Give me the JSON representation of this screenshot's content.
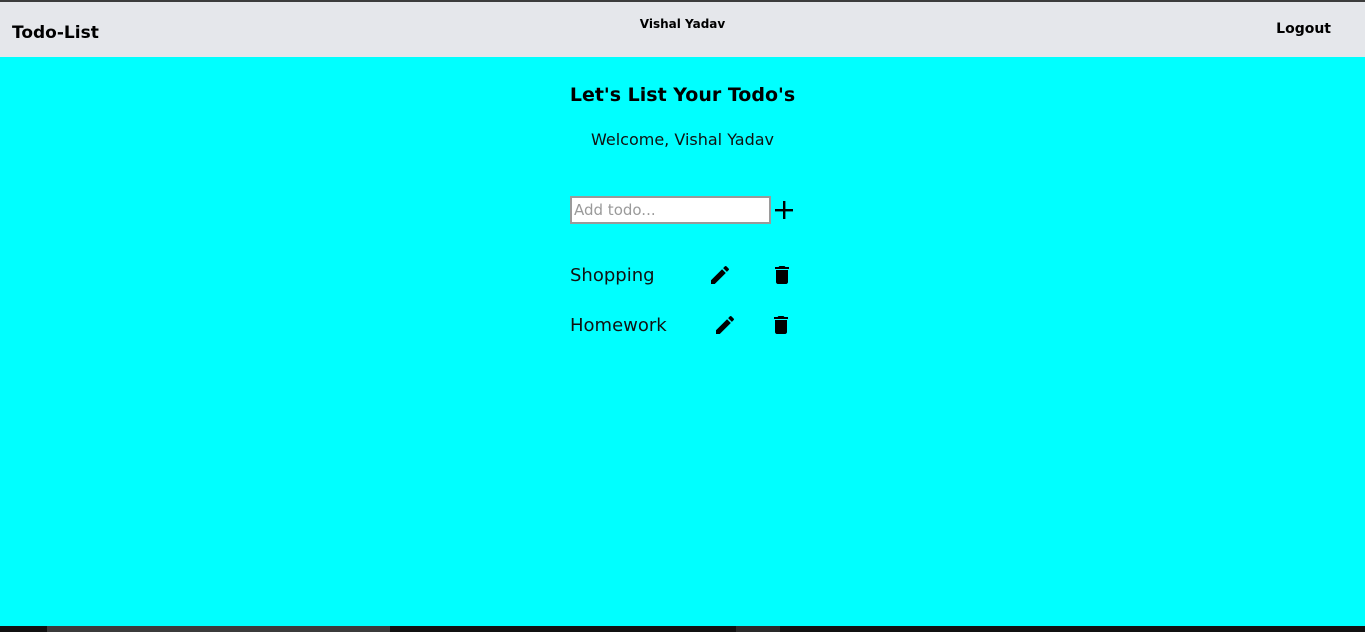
{
  "navbar": {
    "brand": "Todo-List",
    "user_name": "Vishal Yadav",
    "logout_label": "Logout"
  },
  "main": {
    "heading": "Let's List Your Todo's",
    "welcome": "Welcome, Vishal Yadav",
    "add_input": {
      "value": "",
      "placeholder": "Add todo..."
    },
    "add_icon": "plus-icon",
    "todos": [
      {
        "text": "Shopping",
        "edit_icon": "pencil-icon",
        "delete_icon": "trash-icon"
      },
      {
        "text": "Homework",
        "edit_icon": "pencil-icon",
        "delete_icon": "trash-icon"
      }
    ]
  },
  "colors": {
    "page_background": "#00ffff",
    "navbar_background": "#e5e7eb",
    "text": "#000000"
  }
}
